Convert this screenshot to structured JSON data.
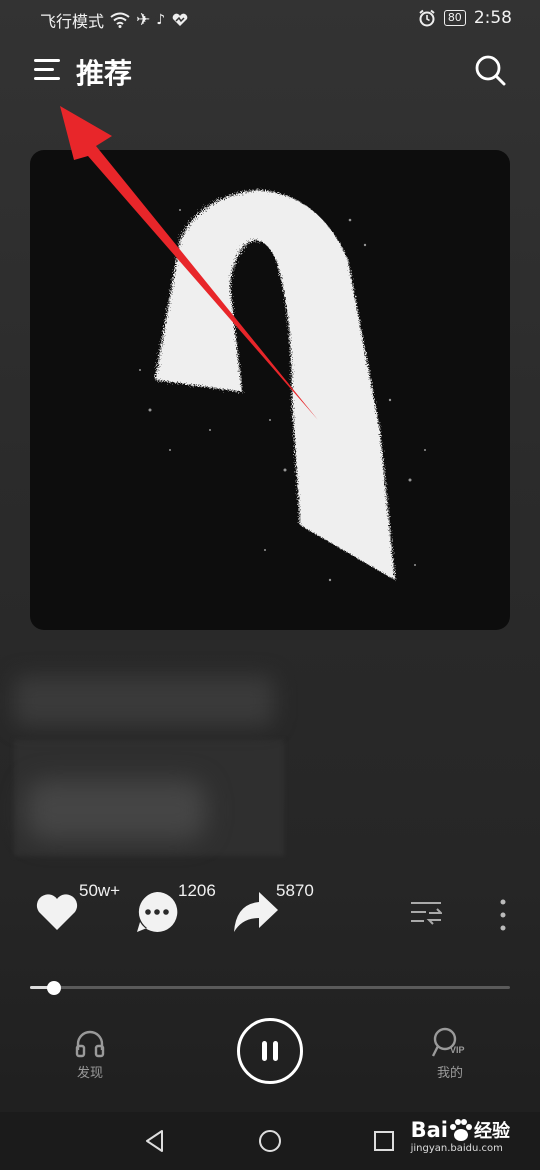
{
  "status_bar": {
    "left_text": "飞行模式",
    "battery": "80",
    "time": "2:58"
  },
  "header": {
    "title": "推荐",
    "menu_icon": "hamburger-menu-icon",
    "search_icon": "search-icon"
  },
  "album_art": {
    "description_icon": "album-cover"
  },
  "actions": {
    "like_count": "50w+",
    "comment_count": "1206",
    "share_count": "5870"
  },
  "player": {
    "progress": 0.05
  },
  "bottom_nav": {
    "discover_label": "发现",
    "mine_label": "我的",
    "vip_badge": "VIP"
  },
  "watermark": {
    "brand": "Bai",
    "brand_suffix": "经验",
    "url": "jingyan.baidu.com"
  },
  "colors": {
    "arrow": "#e8262a",
    "background": "#2b2b2b"
  }
}
